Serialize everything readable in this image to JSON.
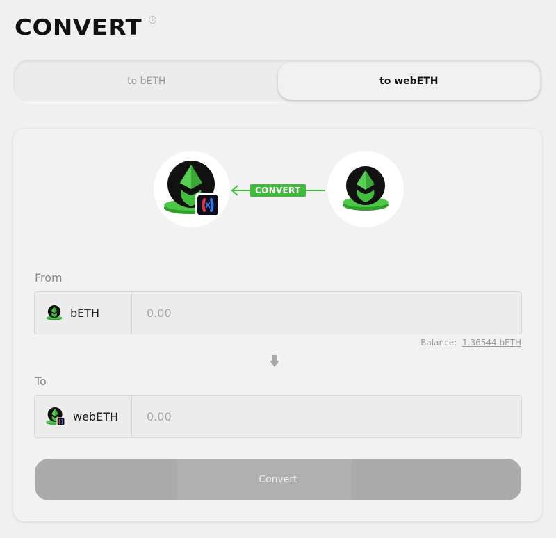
{
  "header": {
    "title": "CONVERT",
    "info_icon": "info-icon"
  },
  "tabs": [
    {
      "label": "to bETH",
      "active": false
    },
    {
      "label": "to webETH",
      "active": true
    }
  ],
  "illustration": {
    "badge_label": "CONVERT",
    "left_token_icon": "webeth-token-icon",
    "right_token_icon": "beth-token-icon",
    "arrow_icon": "arrow-left-icon",
    "accent_color": "#3fbd3a"
  },
  "from": {
    "label": "From",
    "token": "bETH",
    "placeholder": "0.00",
    "balance_label": "Balance:",
    "balance_value": "1.36544 bETH"
  },
  "to": {
    "label": "To",
    "token": "webETH",
    "placeholder": "0.00"
  },
  "divider_icon": "arrow-down-icon",
  "action": {
    "label": "Convert"
  }
}
